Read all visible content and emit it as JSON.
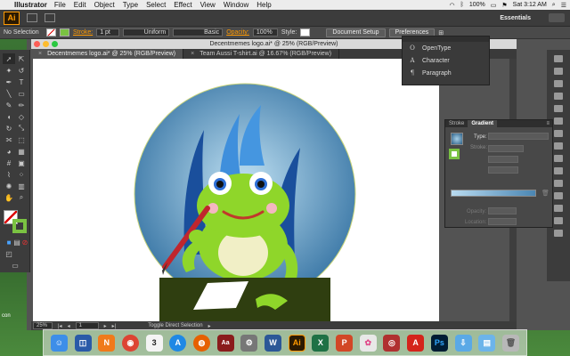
{
  "menubar": {
    "app_name": "Illustrator",
    "items": [
      "File",
      "Edit",
      "Object",
      "Type",
      "Select",
      "Effect",
      "View",
      "Window",
      "Help"
    ],
    "battery": "100%",
    "clock": "Sat 3:12 AM"
  },
  "appbar": {
    "logo": "Ai",
    "workspace": "Essentials"
  },
  "controlbar": {
    "selection": "No Selection",
    "stroke_label": "Stroke:",
    "stroke_weight": "1 pt",
    "profile": "Uniform",
    "brush": "Basic",
    "opacity_label": "Opacity:",
    "opacity_value": "100%",
    "style_label": "Style:",
    "doc_setup": "Document Setup",
    "preferences": "Preferences"
  },
  "document": {
    "window_title": "Decentmemes logo.ai* @ 25% (RGB/Preview)",
    "tabs": [
      {
        "label": "Decentmemes logo.ai* @ 25% (RGB/Preview)",
        "active": true
      },
      {
        "label": "Team Aussi T-shirt.ai @ 16.67% (RGB/Preview)",
        "active": false
      }
    ],
    "zoom": "25%",
    "page": "1",
    "status_text": "Toggle Direct Selection"
  },
  "char_popup": {
    "items": [
      {
        "glyph": "O",
        "label": "OpenType"
      },
      {
        "glyph": "A",
        "label": "Character"
      },
      {
        "glyph": "¶",
        "label": "Paragraph"
      }
    ]
  },
  "gradient_panel": {
    "tabs": [
      "Stroke",
      "Gradient"
    ],
    "type_label": "Type:",
    "stroke_label": "Stroke:",
    "opacity_label": "Opacity:",
    "location_label": "Location:"
  },
  "desktop": {
    "item_label": "con"
  },
  "dock": {
    "apps": [
      {
        "name": "finder-icon",
        "color": "#3d8ee8",
        "glyph": "☺"
      },
      {
        "name": "preview-icon",
        "color": "#2a5aa8",
        "glyph": "◫"
      },
      {
        "name": "notability-icon",
        "color": "#f07a1a",
        "glyph": "N"
      },
      {
        "name": "chrome-icon",
        "color": "#dd4433",
        "glyph": "◉"
      },
      {
        "name": "calendar-icon",
        "color": "#f4f4f4",
        "glyph": "3"
      },
      {
        "name": "appstore-icon",
        "color": "#1e88e5",
        "glyph": "A"
      },
      {
        "name": "firefox-icon",
        "color": "#e66000",
        "glyph": "◍"
      },
      {
        "name": "dictionary-icon",
        "color": "#8a1c1c",
        "glyph": "Aa"
      },
      {
        "name": "system-preferences-icon",
        "color": "#777777",
        "glyph": "⚙"
      },
      {
        "name": "word-icon",
        "color": "#2b5797",
        "glyph": "W"
      },
      {
        "name": "illustrator-icon",
        "color": "#2b1a02",
        "glyph": "Ai"
      },
      {
        "name": "excel-icon",
        "color": "#1e7145",
        "glyph": "X"
      },
      {
        "name": "powerpoint-icon",
        "color": "#d24726",
        "glyph": "P"
      },
      {
        "name": "photos-icon",
        "color": "#e8e8e8",
        "glyph": "✿"
      },
      {
        "name": "photo-booth-icon",
        "color": "#b03030",
        "glyph": "◎"
      },
      {
        "name": "acrobat-icon",
        "color": "#d4241b",
        "glyph": "A"
      },
      {
        "name": "photoshop-icon",
        "color": "#001d34",
        "glyph": "Ps"
      },
      {
        "name": "downloads-folder-icon",
        "color": "#5aa9e6",
        "glyph": "⇩"
      },
      {
        "name": "documents-folder-icon",
        "color": "#6cb4ea",
        "glyph": "▤"
      },
      {
        "name": "trash-icon",
        "color": "#b8b8b8",
        "glyph": "🗑"
      }
    ]
  }
}
